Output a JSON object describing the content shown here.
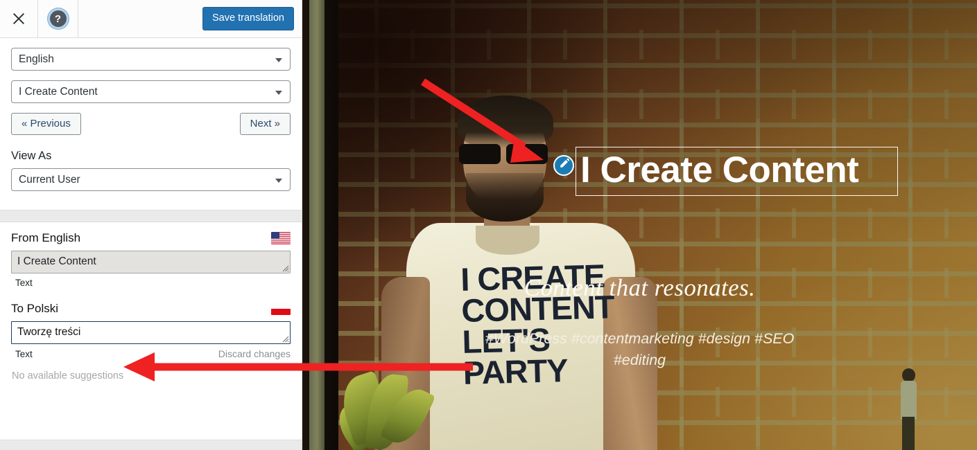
{
  "header": {
    "close_icon": "close-x-icon",
    "help_icon": "help-question-icon",
    "save_label": "Save translation"
  },
  "sidebar": {
    "language_select": {
      "value": "English",
      "caret_icon": "chevron-down-icon"
    },
    "page_select": {
      "value": "I Create Content",
      "caret_icon": "chevron-down-icon"
    },
    "previous_label": "« Previous",
    "next_label": "Next »",
    "view_as_label": "View As",
    "view_as_select": {
      "value": "Current User",
      "caret_icon": "chevron-down-icon"
    }
  },
  "translation": {
    "source": {
      "heading": "From English",
      "flag_icon": "flag-usa-icon",
      "value": "I Create Content",
      "type_label": "Text"
    },
    "target": {
      "heading": "To Polski",
      "flag_icon": "flag-poland-icon",
      "value": "Tworzę treści",
      "type_label": "Text",
      "discard_label": "Discard changes",
      "suggestions_label": "No available suggestions"
    }
  },
  "preview": {
    "edit_pin_icon": "pencil-edit-icon",
    "title": "I Create Content",
    "tagline": "Content that resonates.",
    "hashtags_line1": "#WordPress #contentmarketing #design #SEO",
    "hashtags_line2": "#editing",
    "shirt_text": [
      "I CREATE",
      "CONTENT",
      "LET'S",
      "PARTY"
    ]
  },
  "colors": {
    "accent_blue": "#2271b1",
    "pin_blue": "#1b7cb5",
    "annotation_red": "#ee2222",
    "focus_border": "#1a3c5a",
    "sidebar_bg": "#ffffff",
    "divider": "#eaeaea"
  }
}
